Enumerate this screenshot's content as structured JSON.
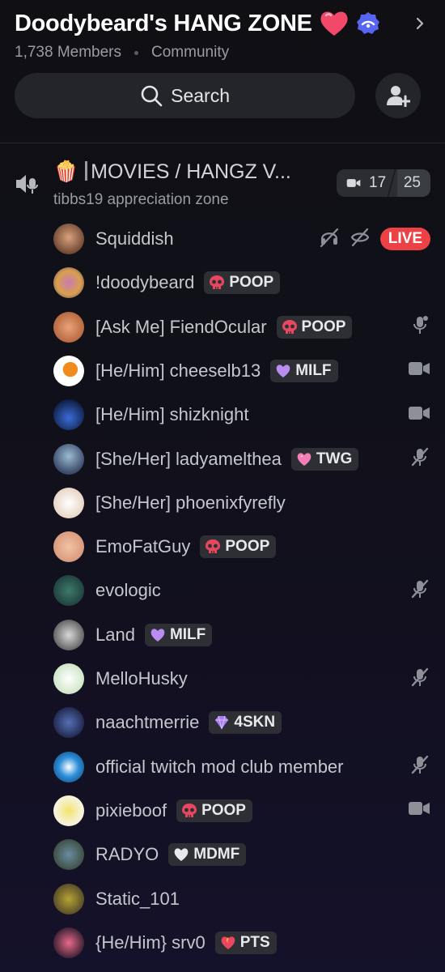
{
  "server": {
    "name": "Doodybeard's HANG ZONE",
    "members_label": "1,738 Members",
    "type_label": "Community",
    "icons": [
      "heart-emoji",
      "verified-partner-icon",
      "chevron-right-icon"
    ]
  },
  "search": {
    "label": "Search",
    "icon": "search-icon"
  },
  "invite": {
    "icon": "add-member-icon"
  },
  "channel": {
    "emoji": "🍿",
    "name": "MOVIES / HANGZ V...",
    "subtitle": "tibbs19 appreciation zone",
    "video_count": "17",
    "user_limit": "25",
    "icon": "voice-channel-icon"
  },
  "colors": {
    "live": "#ed4245",
    "badge_bg": "#2e2f35",
    "accent_verified": "#5865f2"
  },
  "members": [
    {
      "name": "Squiddish",
      "badge": null,
      "status": [
        "deafened-icon",
        "camera-off-icon"
      ],
      "live_label": "LIVE"
    },
    {
      "name": "!doodybeard",
      "badge": {
        "label": "POOP",
        "icon": "skull-icon"
      },
      "status": []
    },
    {
      "name": "[Ask Me] FiendOcular",
      "badge": {
        "label": "POOP",
        "icon": "skull-icon"
      },
      "status": [
        "microphone-icon"
      ]
    },
    {
      "name": "[He/Him] cheeselb13",
      "badge": {
        "label": "MILF",
        "icon": "purple-heart-icon"
      },
      "status": [
        "video-icon"
      ]
    },
    {
      "name": "[He/Him] shizknight",
      "badge": null,
      "status": [
        "video-icon"
      ]
    },
    {
      "name": "[She/Her] ladyamelthea",
      "badge": {
        "label": "TWG",
        "icon": "pink-heart-icon"
      },
      "status": [
        "mic-muted-icon"
      ]
    },
    {
      "name": "[She/Her] phoenixfyrefly",
      "badge": null,
      "status": []
    },
    {
      "name": "EmoFatGuy",
      "badge": {
        "label": "POOP",
        "icon": "skull-icon"
      },
      "status": []
    },
    {
      "name": "evologic",
      "badge": null,
      "status": [
        "mic-muted-icon"
      ]
    },
    {
      "name": "Land",
      "badge": {
        "label": "MILF",
        "icon": "purple-heart-icon"
      },
      "status": []
    },
    {
      "name": "MelloHusky",
      "badge": null,
      "status": [
        "mic-muted-icon"
      ]
    },
    {
      "name": "naachtmerrie",
      "badge": {
        "label": "4SKN",
        "icon": "gem-icon"
      },
      "status": []
    },
    {
      "name": "official twitch mod club member",
      "badge": null,
      "status": [
        "mic-muted-icon"
      ]
    },
    {
      "name": "pixieboof",
      "badge": {
        "label": "POOP",
        "icon": "skull-icon"
      },
      "status": [
        "video-icon"
      ]
    },
    {
      "name": "RADYO",
      "badge": {
        "label": "MDMF",
        "icon": "white-heart-icon"
      },
      "status": []
    },
    {
      "name": "Static_101",
      "badge": null,
      "status": []
    },
    {
      "name": "{He/Him} srv0",
      "badge": {
        "label": "PTS",
        "icon": "fire-heart-icon"
      },
      "status": []
    }
  ]
}
